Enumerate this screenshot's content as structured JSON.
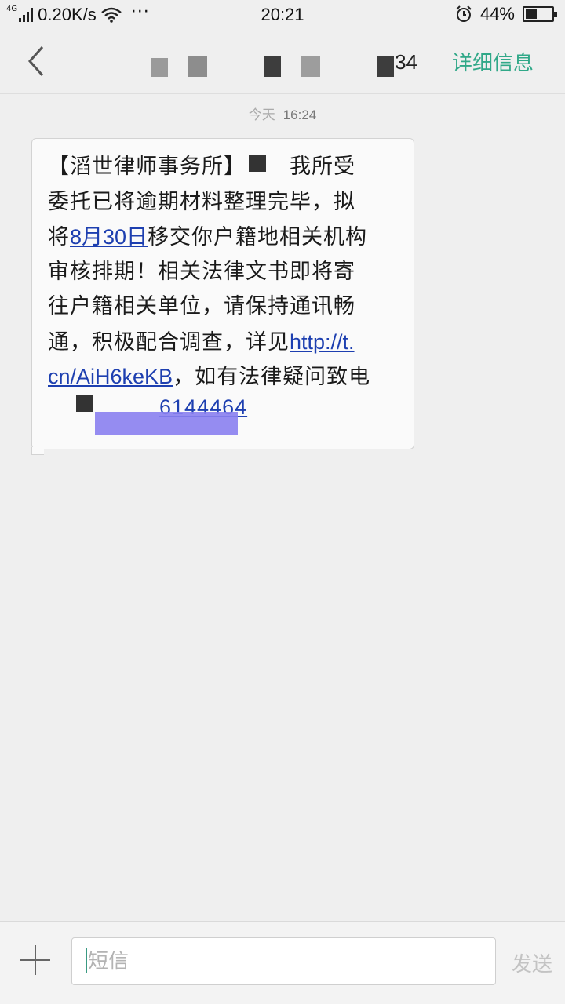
{
  "status_bar": {
    "network": "4G",
    "speed": "0.20K/s",
    "more": "···",
    "time": "20:21",
    "battery_text": "44%",
    "battery_level": 0.44
  },
  "header": {
    "contact_suffix": "34",
    "details_label": "详细信息"
  },
  "conversation": {
    "timestamp_day": "今天",
    "timestamp_time": "16:24",
    "message": {
      "line1_pre": "【滔世律师事务所】",
      "line1_post": "我所受",
      "line2": "委托已将逾期材料整理完毕，拟",
      "line3_pre": "将",
      "date_link": "8月30日",
      "line3_post": "移交你户籍地相关机构",
      "line4": "审核排期！相关法律文书即将寄",
      "line5": "往户籍相关单位，请保持通讯畅",
      "line6_pre": "通，积极配合调查，详见",
      "url_part1": "http://t.",
      "url_part2": "cn/AiH6keKB",
      "line7_post": "，如有法律疑问致电",
      "phone_visible": "6144464"
    }
  },
  "composer": {
    "placeholder": "短信",
    "send_label": "发送"
  },
  "colors": {
    "accent": "#30a888",
    "link": "#1d3fb0"
  }
}
